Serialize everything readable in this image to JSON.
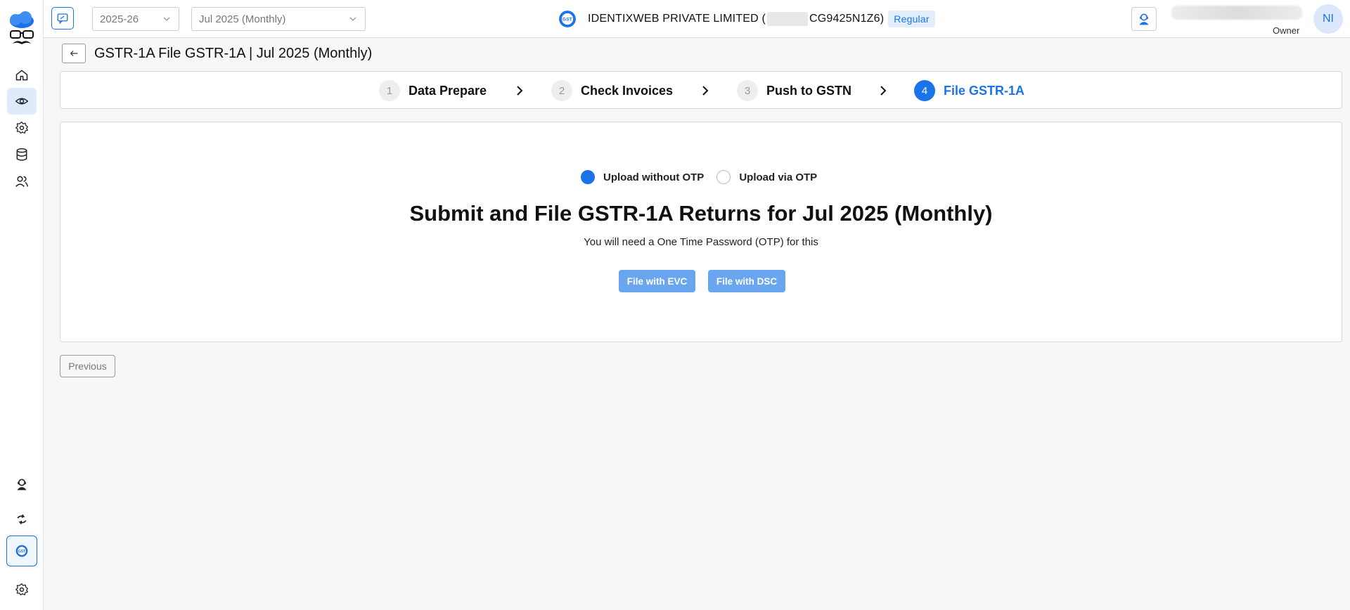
{
  "topbar": {
    "fiscal_year": "2025-26",
    "period": "Jul 2025 (Monthly)",
    "company_prefix": "IDENTIXWEB PRIVATE LIMITED (",
    "company_gstin_suffix": "CG9425N1Z6)",
    "company_type_badge": "Regular",
    "user_role": "Owner",
    "user_initials": "NI"
  },
  "page": {
    "title": "GSTR-1A File GSTR-1A | Jul 2025 (Monthly)"
  },
  "stepper": {
    "steps": [
      {
        "num": "1",
        "label": "Data Prepare"
      },
      {
        "num": "2",
        "label": "Check Invoices"
      },
      {
        "num": "3",
        "label": "Push to GSTN"
      },
      {
        "num": "4",
        "label": "File GSTR-1A"
      }
    ]
  },
  "filing": {
    "option_without_otp": "Upload without OTP",
    "option_via_otp": "Upload via OTP",
    "heading": "Submit and File GSTR-1A Returns for Jul 2025 (Monthly)",
    "subtext": "You will need a One Time Password (OTP) for this",
    "evc_label": "File with EVC",
    "dsc_label": "File with DSC"
  },
  "footer": {
    "previous_label": "Previous"
  },
  "colors": {
    "accent": "#1a73e8",
    "button_disabled": "#6aa5f0",
    "badge_bg": "#e3eefc"
  }
}
